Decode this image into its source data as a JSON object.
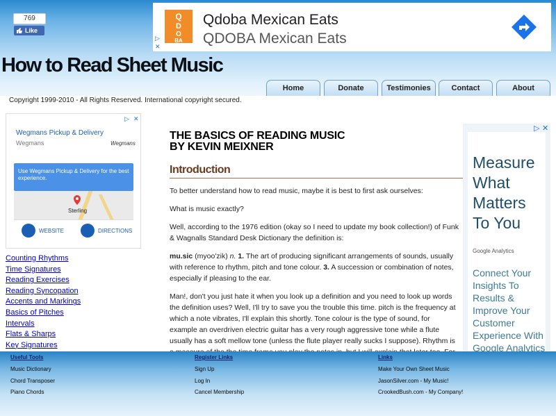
{
  "facebook": {
    "count": "769",
    "button_label": "Like"
  },
  "top_ad": {
    "title": "Qdoba Mexican Eats",
    "subtitle": "QDOBA Mexican Eats",
    "logo_text": "QDOBA"
  },
  "site": {
    "title": "How to Read Sheet Music"
  },
  "nav": {
    "home": "Home",
    "donate": "Donate",
    "testimonies": "Testimonies",
    "contact": "Contact",
    "about": "About"
  },
  "copyright": "Copyright 1999-2010 - All Rights Reserved. International copyright secured.",
  "left_ad": {
    "headline": "Wegmans Pickup & Delivery",
    "advertiser": "Wegmans",
    "brand_logo": "Wegmans",
    "promo": "Use Wegmans Pickup & Delivery for the best experience.",
    "map_label": "Sterling",
    "website_label": "WEBSITE",
    "directions_label": "DIRECTIONS"
  },
  "sidenav": {
    "items": [
      "Counting Rhythms",
      "Time Signatures",
      "Reading Exercises",
      "Reading Syncopation",
      "Accents and Markings",
      "Basics of Pitches",
      "Intervals",
      "Flats & Sharps",
      "Key Signatures"
    ]
  },
  "main": {
    "title_line1": "THE BASICS OF READING MUSIC",
    "title_line2": "BY KEVIN MEIXNER",
    "section_heading": "Introduction",
    "p1": "To better understand how to read music, maybe it is best to first ask ourselves:",
    "p2": "What is music exactly?",
    "p3": "Well, according to the 1976 edition (okay so I need to update my book collection!) of Funk & Wagnalls Standard Desk Dictionary the definition is:",
    "def_word": "mu.sic",
    "def_pron": "(myoo'zik)",
    "def_pos": "n.",
    "def_n1": "1.",
    "def_text1": "The art of producing significant arrangements of sounds, usually with reference to rhythm, pitch and tone colour.",
    "def_n3": "3.",
    "def_text3": "A succession or combination of notes, especially if pleasing to the ear.",
    "p4": "Man!, don't you just hate it when you look up a definition and you need to look up words the definition uses? Well, I'll try to save you the trouble this time. pitch is the frequency at which a note vibrates, I'll explain this shortly. Tone colour is the type of sound, for example an overdriven electric guitar has a very rough aggressive tone while a flute usually has a soft mellow tone (unless the flute player really sucks I suppose). Rhythm is a measure of the the time frame you play the notes in, but I will explain that later too. For now, let's just"
  },
  "right_ad": {
    "headline": "Measure What Matters To You",
    "brand": "Google Analytics",
    "body": "Connect Your Insights To Results & Improve Your Customer Experience With Google Analytics"
  },
  "footer": {
    "useful_tools": {
      "heading": "Useful Tools",
      "links": [
        "Music Dictionary",
        "Chord Transposer",
        "Piano Chords"
      ]
    },
    "register_links": {
      "heading": "Register Links",
      "links": [
        "Sign Up",
        "Log In",
        "Cancel Membership"
      ]
    },
    "links": {
      "heading": "Links",
      "links": [
        "Make Your Own Sheet Music",
        "JasonSilver.com - My Music!",
        "CrookedBush.com - My Company!"
      ]
    }
  },
  "colors": {
    "header_blue": "#2a8ad0",
    "link_blue": "#0000cc",
    "heading_brown": "#6b3a1e",
    "qdoba_orange": "#f28c28",
    "ad_blue": "#1a73e8"
  }
}
